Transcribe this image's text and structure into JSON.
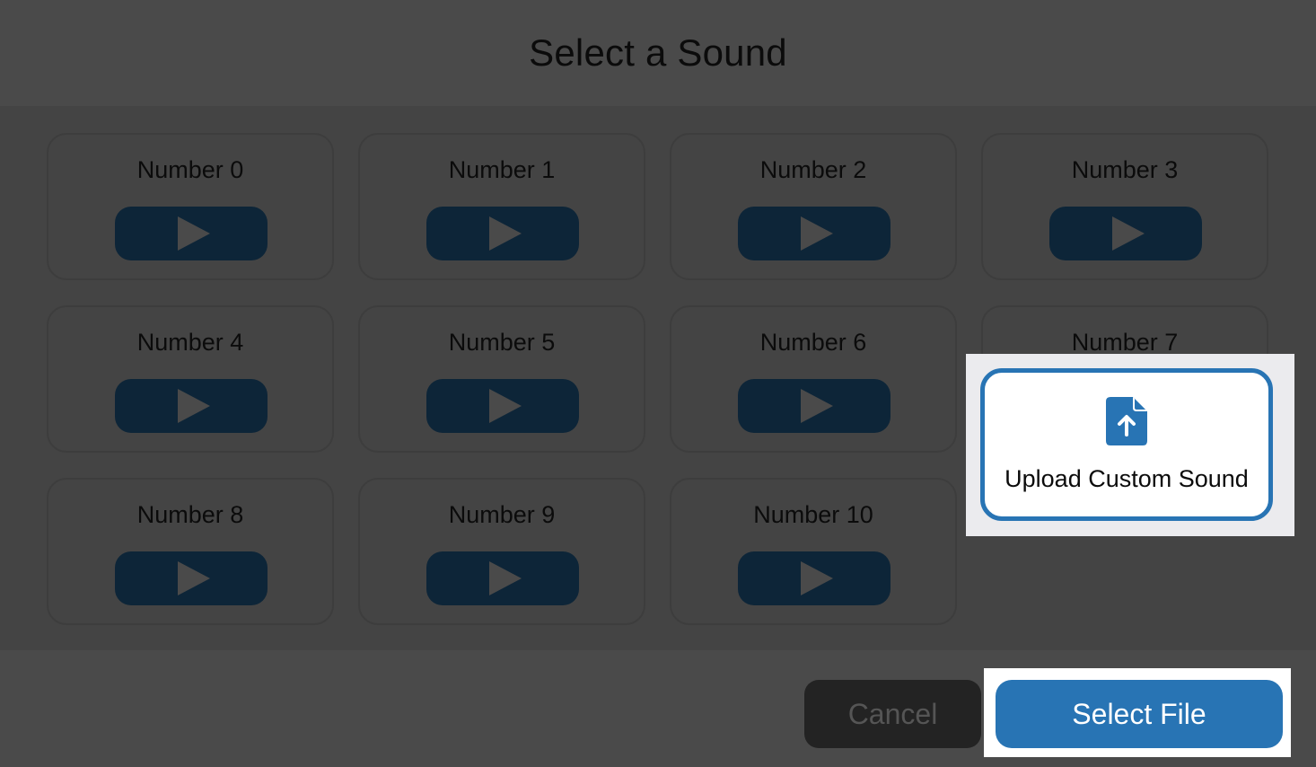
{
  "dialog": {
    "title": "Select a Sound"
  },
  "sounds": [
    {
      "label": "Number 0"
    },
    {
      "label": "Number 1"
    },
    {
      "label": "Number 2"
    },
    {
      "label": "Number 3"
    },
    {
      "label": "Number 4"
    },
    {
      "label": "Number 5"
    },
    {
      "label": "Number 6"
    },
    {
      "label": "Number 7"
    },
    {
      "label": "Number 8"
    },
    {
      "label": "Number 9"
    },
    {
      "label": "Number 10"
    }
  ],
  "play_icon": "play-icon",
  "upload": {
    "label": "Upload Custom Sound",
    "icon": "file-upload-icon"
  },
  "footer": {
    "cancel_label": "Cancel",
    "select_label": "Select File"
  },
  "colors": {
    "accent": "#2874b4",
    "play_button": "#0d2538",
    "background": "#4a4a4a"
  }
}
